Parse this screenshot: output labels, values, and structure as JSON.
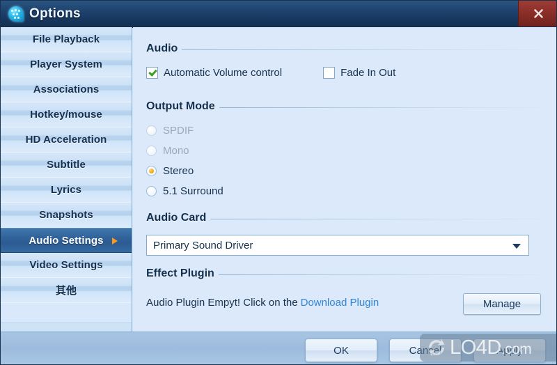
{
  "window": {
    "title": "Options",
    "icon": "player-bubble-icon",
    "close_label": "×",
    "accent_selected": "#31639b",
    "accent_radio": "#f2a712",
    "accent_check": "#3f9b21",
    "link_color": "#2f86d6"
  },
  "sidebar": {
    "items": [
      {
        "label": "File Playback",
        "selected": false
      },
      {
        "label": "Player System",
        "selected": false
      },
      {
        "label": "Associations",
        "selected": false
      },
      {
        "label": "Hotkey/mouse",
        "selected": false
      },
      {
        "label": "HD Acceleration",
        "selected": false
      },
      {
        "label": "Subtitle",
        "selected": false
      },
      {
        "label": "Lyrics",
        "selected": false
      },
      {
        "label": "Snapshots",
        "selected": false
      },
      {
        "label": "Audio Settings",
        "selected": true
      },
      {
        "label": "Video Settings",
        "selected": false
      },
      {
        "label": "其他",
        "selected": false
      }
    ]
  },
  "content": {
    "audio": {
      "heading": "Audio",
      "checkboxes": [
        {
          "label": "Automatic Volume control",
          "checked": true
        },
        {
          "label": "Fade In Out",
          "checked": false
        }
      ]
    },
    "output_mode": {
      "heading": "Output Mode",
      "options": [
        {
          "label": "SPDIF",
          "selected": false,
          "disabled": true
        },
        {
          "label": "Mono",
          "selected": false,
          "disabled": true
        },
        {
          "label": "Stereo",
          "selected": true,
          "disabled": false
        },
        {
          "label": "5.1 Surround",
          "selected": false,
          "disabled": false
        }
      ]
    },
    "audio_card": {
      "heading": "Audio Card",
      "value": "Primary Sound Driver"
    },
    "effect_plugin": {
      "heading": "Effect Plugin",
      "message": "Audio Plugin Empyt! Click on the",
      "link": "Download Plugin",
      "manage_label": "Manage"
    }
  },
  "footer": {
    "ok_label": "OK",
    "cancel_label": "Cancel",
    "apply_label": "Apply"
  },
  "watermark": {
    "text": "LO4D",
    "suffix": ".com"
  }
}
